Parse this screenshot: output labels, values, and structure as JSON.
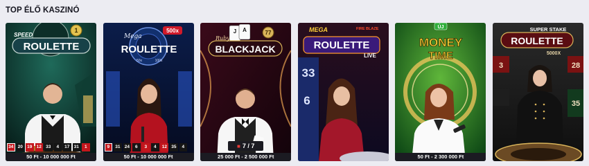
{
  "section": {
    "title": "TOP ÉLŐ KASZINÓ"
  },
  "games": [
    {
      "id": "speed-roulette",
      "logo": {
        "line1": "SPEED",
        "line2": "ROULETTE"
      },
      "badge": "1",
      "stake": "50 Ft - 10 000 000 Ft",
      "results": [
        {
          "n": "34",
          "color": "red"
        },
        {
          "n": "20",
          "color": "black"
        },
        {
          "n": "19",
          "color": "red"
        },
        {
          "n": "12",
          "color": "red"
        },
        {
          "n": "33",
          "color": "black"
        },
        {
          "n": "4",
          "color": "black"
        },
        {
          "n": "17",
          "color": "black"
        },
        {
          "n": "31",
          "color": "black"
        },
        {
          "n": "1",
          "color": "red"
        }
      ]
    },
    {
      "id": "mega-roulette",
      "logo": {
        "line1": "Mega",
        "line2": "ROULETTE"
      },
      "badge": "500x",
      "wheel_labels": [
        "50x",
        "100x"
      ],
      "stake": "50 Ft - 10 000 000 Ft",
      "results": [
        {
          "n": "9",
          "color": "red"
        },
        {
          "n": "31",
          "color": "black"
        },
        {
          "n": "24",
          "color": "black"
        },
        {
          "n": "6",
          "color": "black"
        },
        {
          "n": "3",
          "color": "red"
        },
        {
          "n": "4",
          "color": "black"
        },
        {
          "n": "12",
          "color": "red"
        },
        {
          "n": "35",
          "color": "black"
        },
        {
          "n": "4",
          "color": "black"
        }
      ]
    },
    {
      "id": "ruby-blackjack",
      "logo": {
        "line1": "Ruby",
        "line2": "BLACKJACK"
      },
      "badge": "77",
      "seats": "7 / 7",
      "stake": "25 000 Ft - 2 500 000 Ft"
    },
    {
      "id": "mega-fire-blaze-roulette",
      "logo": {
        "line1": "MEGA",
        "line1b": "FIRE BLAZE",
        "line2": "ROULETTE",
        "line3": "LIVE"
      },
      "backdrop_numbers": [
        "33",
        "6"
      ]
    },
    {
      "id": "money-time",
      "tag": "ÚJ",
      "logo": {
        "line1": "MONEY",
        "line2": "TIME"
      },
      "stake": "50 Ft - 2 300 000 Ft"
    },
    {
      "id": "super-stake-roulette",
      "logo": {
        "line1": "SUPER STAKE",
        "line2": "ROULETTE",
        "line3": "5000X"
      },
      "backdrop_numbers": [
        "3",
        "28",
        "35"
      ]
    }
  ],
  "colors": {
    "red": "#c4161c",
    "gold": "#d9b45a",
    "page_bg": "#ececf2"
  }
}
